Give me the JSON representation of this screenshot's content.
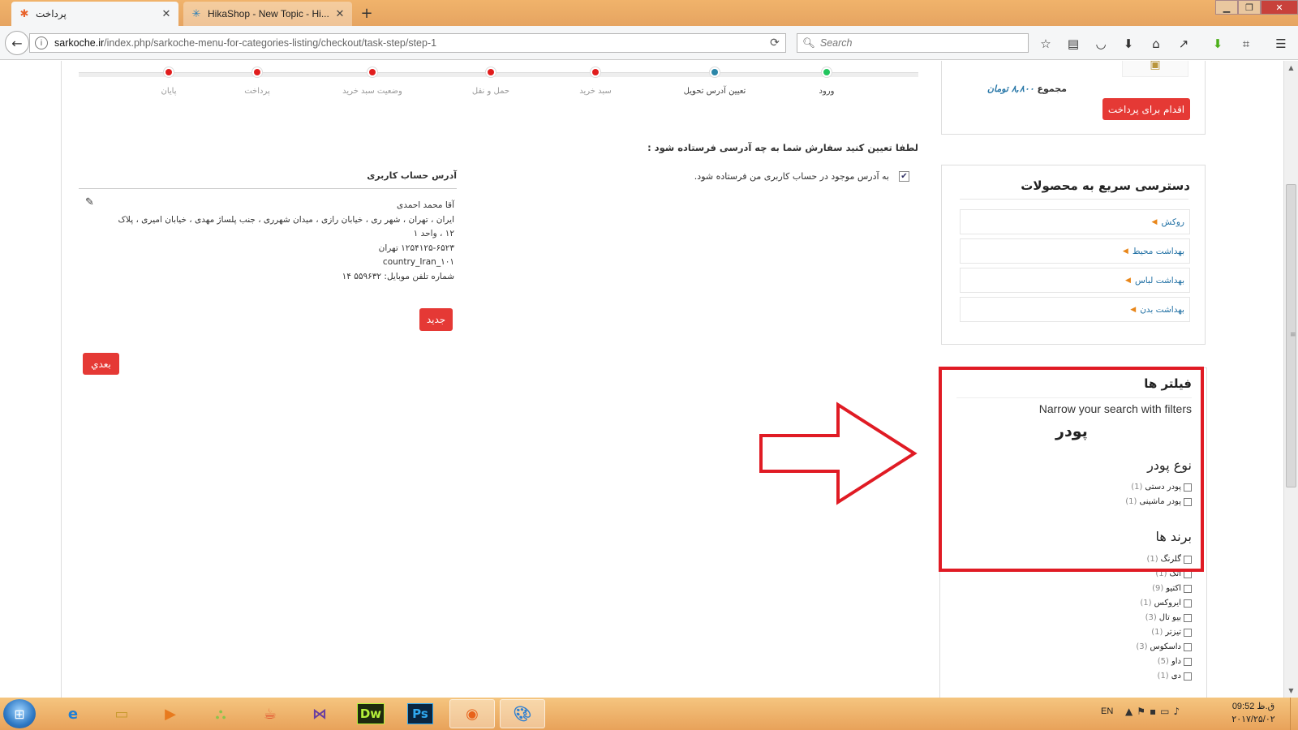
{
  "browser": {
    "tabs": [
      {
        "label": "پرداخت",
        "icon": "joomla-icon"
      },
      {
        "label": "HikaShop - New Topic - Hi...",
        "icon": "hikashop-icon"
      }
    ],
    "url": {
      "host": "sarkoche.ir",
      "path": "/index.php/sarkoche-menu-for-categories-listing/checkout/task-step/step-1"
    },
    "search_placeholder": "Search"
  },
  "steps": [
    {
      "label": "ورود",
      "color": "#22c55e"
    },
    {
      "label": "تعیین آدرس تحویل",
      "color": "#2b86a8"
    },
    {
      "label": "سبد خرید",
      "color": "#e11d1d"
    },
    {
      "label": "حمل و نقل",
      "color": "#e11d1d"
    },
    {
      "label": "وضعیت سبد خرید",
      "color": "#e11d1d"
    },
    {
      "label": "پرداخت",
      "color": "#e11d1d"
    },
    {
      "label": "پایان",
      "color": "#e11d1d"
    }
  ],
  "checkout": {
    "question": "لطفا تعیین کنید سفارش شما به چه آدرسی فرستاده شود :",
    "same_address_label": "به آدرس موجود در حساب کاربری من فرستاده شود.",
    "same_address_checked": true,
    "address_heading": "آدرس حساب کاربری",
    "address_lines": [
      "آقا محمد احمدی",
      "ایران ، تهران ، شهر ری ، خیابان رازی ، میدان شهرری ، جنب پلساژ مهدی ، خیابان امیری ، پلاک",
      "۱۲ ، واحد ۱",
      "۱۲۵۴۱۲۵-۶۵۲۳ تهران",
      "country_Iran_۱۰۱",
      "شماره تلفن موبایل: ۵۵۹۶۳۲ ۱۴"
    ],
    "new_button": "جدید",
    "next_button": "بعدي"
  },
  "cart": {
    "total_label": "مجموع",
    "total_amount": "۸,۸۰۰ تومان",
    "pay_button": "اقدام برای پرداخت"
  },
  "quick_access": {
    "title": "دسترسی سریع به محصولات",
    "items": [
      "روکش",
      "بهداشت محیط",
      "بهداشت لباس",
      "بهداشت بدن"
    ]
  },
  "filters": {
    "title": "فیلتر ها",
    "hint": "Narrow your search with filters",
    "product": "پودر",
    "powder_type_title": "نوع پودر",
    "powder_types": [
      {
        "label": "پودر دستی",
        "count": "(1)"
      },
      {
        "label": "پودر ماشینی",
        "count": "(1)"
      }
    ],
    "brands_title": "برند ها",
    "brands": [
      {
        "label": "گلرنگ",
        "count": "(1)"
      },
      {
        "label": "اتک",
        "count": "(1)"
      },
      {
        "label": "اکتیو",
        "count": "(9)"
      },
      {
        "label": "ایروکس",
        "count": "(1)"
      },
      {
        "label": "بیو تال",
        "count": "(3)"
      },
      {
        "label": "تیزتر",
        "count": "(1)"
      },
      {
        "label": "داسکوس",
        "count": "(3)"
      },
      {
        "label": "داو",
        "count": "(5)"
      },
      {
        "label": "دی",
        "count": "(1)"
      }
    ]
  },
  "annotation": {
    "frame_color": "#e01b24"
  },
  "taskbar": {
    "lang": "EN",
    "time": "09:52 ق.ظ",
    "date": "۲۰۱۷/۲۵/۰۲",
    "apps": [
      "ie-icon",
      "explorer-icon",
      "media-player-icon",
      "android-icon",
      "java-icon",
      "visual-studio-icon",
      "dreamweaver-icon",
      "photoshop-icon",
      "firefox-icon",
      "paint-icon"
    ]
  }
}
